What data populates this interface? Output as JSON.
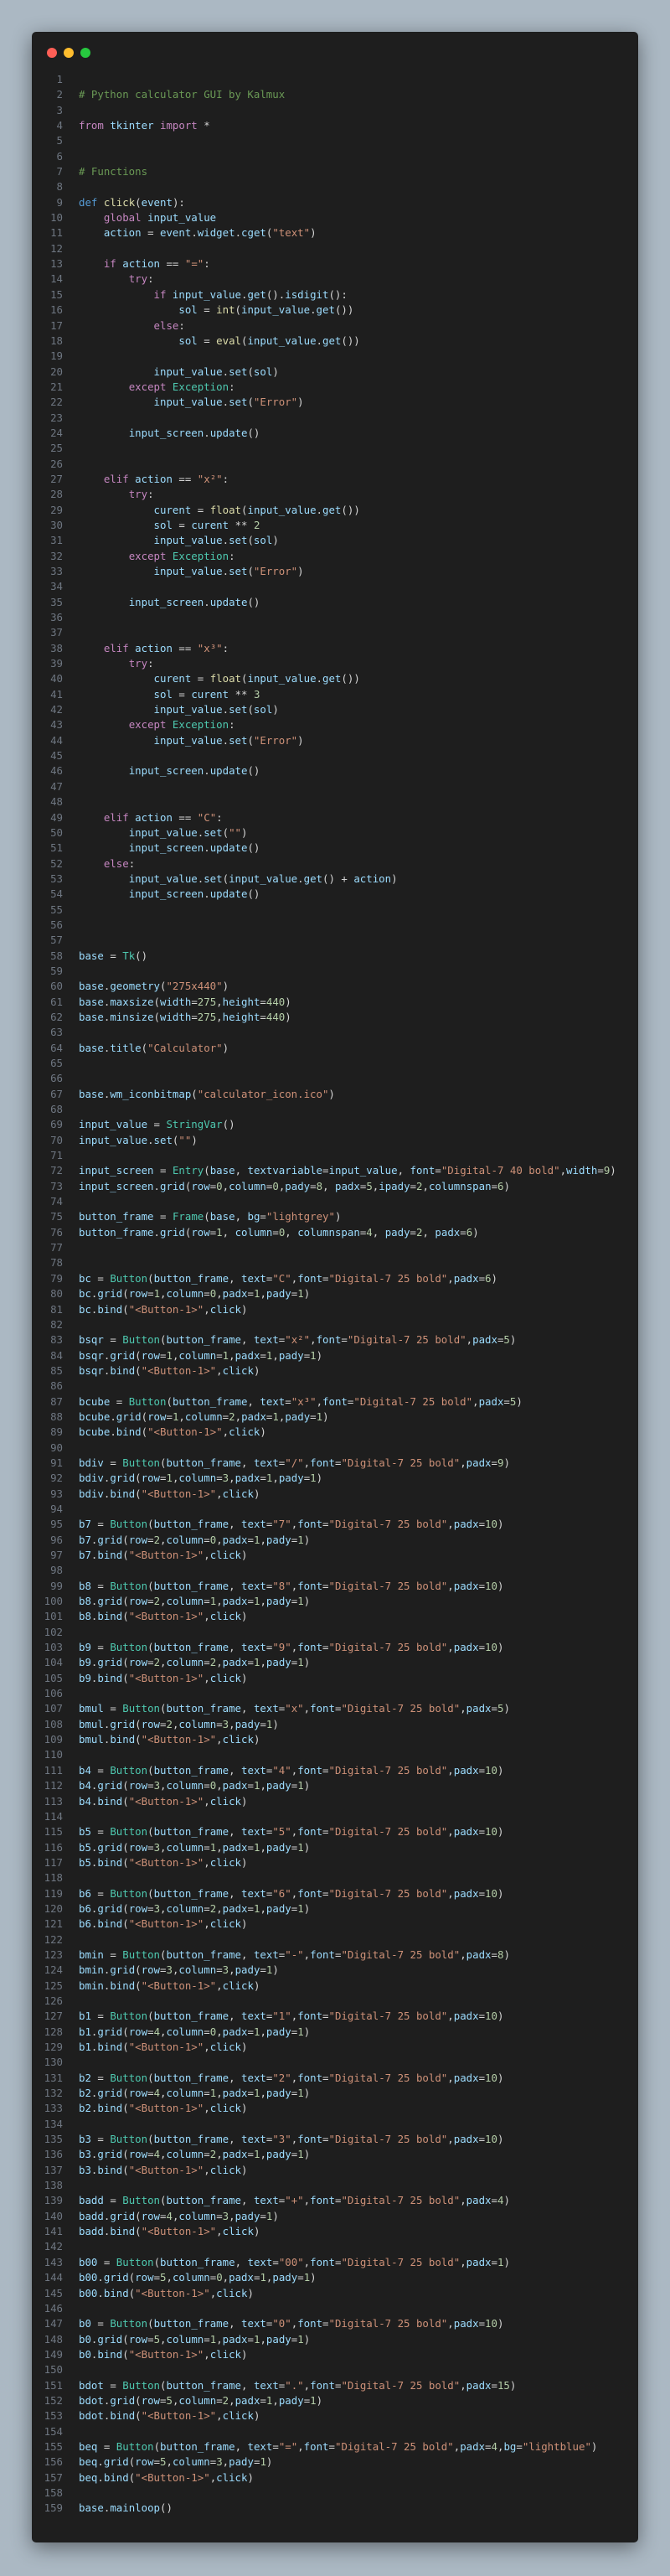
{
  "window": {
    "title_bar_buttons": [
      {
        "name": "close",
        "color": "#ff5f56"
      },
      {
        "name": "minimize",
        "color": "#ffbd2e"
      },
      {
        "name": "maximize",
        "color": "#27c93f"
      }
    ]
  },
  "theme": {
    "background": "#abb8c3",
    "editor_background": "#1e1e1e",
    "line_number_color": "#6e7681",
    "comment": "#6a9955",
    "keyword": "#c586c0",
    "string": "#ce9178",
    "number": "#b5cea8",
    "class": "#4ec9b0",
    "variable": "#9cdcfe"
  },
  "code": {
    "language": "python",
    "lines": [
      "",
      "# Python calculator GUI by Kalmux",
      "",
      "from tkinter import *",
      "",
      "",
      "# Functions",
      "",
      "def click(event):",
      "    global input_value",
      "    action = event.widget.cget(\"text\")",
      "",
      "    if action == \"=\":",
      "        try:",
      "            if input_value.get().isdigit():",
      "                sol = int(input_value.get())",
      "            else:",
      "                sol = eval(input_value.get())",
      "",
      "            input_value.set(sol)",
      "        except Exception:",
      "            input_value.set(\"Error\")",
      "",
      "        input_screen.update()",
      "",
      "",
      "    elif action == \"x²\":",
      "        try:",
      "            curent = float(input_value.get())",
      "            sol = curent ** 2",
      "            input_value.set(sol)",
      "        except Exception:",
      "            input_value.set(\"Error\")",
      "",
      "        input_screen.update()",
      "",
      "",
      "    elif action == \"x³\":",
      "        try:",
      "            curent = float(input_value.get())",
      "            sol = curent ** 3",
      "            input_value.set(sol)",
      "        except Exception:",
      "            input_value.set(\"Error\")",
      "",
      "        input_screen.update()",
      "",
      "",
      "    elif action == \"C\":",
      "        input_value.set(\"\")",
      "        input_screen.update()",
      "    else:",
      "        input_value.set(input_value.get() + action)",
      "        input_screen.update()",
      "",
      "",
      "",
      "base = Tk()",
      "",
      "base.geometry(\"275x440\")",
      "base.maxsize(width=275,height=440)",
      "base.minsize(width=275,height=440)",
      "",
      "base.title(\"Calculator\")",
      "",
      "",
      "base.wm_iconbitmap(\"calculator_icon.ico\")",
      "",
      "input_value = StringVar()",
      "input_value.set(\"\")",
      "",
      "input_screen = Entry(base, textvariable=input_value, font=\"Digital-7 40 bold\",width=9)",
      "input_screen.grid(row=0,column=0,pady=8, padx=5,ipady=2,columnspan=6)",
      "",
      "button_frame = Frame(base, bg=\"lightgrey\")",
      "button_frame.grid(row=1, column=0, columnspan=4, pady=2, padx=6)",
      "",
      "",
      "bc = Button(button_frame, text=\"C\",font=\"Digital-7 25 bold\",padx=6)",
      "bc.grid(row=1,column=0,padx=1,pady=1)",
      "bc.bind(\"<Button-1>\",click)",
      "",
      "bsqr = Button(button_frame, text=\"x²\",font=\"Digital-7 25 bold\",padx=5)",
      "bsqr.grid(row=1,column=1,padx=1,pady=1)",
      "bsqr.bind(\"<Button-1>\",click)",
      "",
      "bcube = Button(button_frame, text=\"x³\",font=\"Digital-7 25 bold\",padx=5)",
      "bcube.grid(row=1,column=2,padx=1,pady=1)",
      "bcube.bind(\"<Button-1>\",click)",
      "",
      "bdiv = Button(button_frame, text=\"/\",font=\"Digital-7 25 bold\",padx=9)",
      "bdiv.grid(row=1,column=3,padx=1,pady=1)",
      "bdiv.bind(\"<Button-1>\",click)",
      "",
      "b7 = Button(button_frame, text=\"7\",font=\"Digital-7 25 bold\",padx=10)",
      "b7.grid(row=2,column=0,padx=1,pady=1)",
      "b7.bind(\"<Button-1>\",click)",
      "",
      "b8 = Button(button_frame, text=\"8\",font=\"Digital-7 25 bold\",padx=10)",
      "b8.grid(row=2,column=1,padx=1,pady=1)",
      "b8.bind(\"<Button-1>\",click)",
      "",
      "b9 = Button(button_frame, text=\"9\",font=\"Digital-7 25 bold\",padx=10)",
      "b9.grid(row=2,column=2,padx=1,pady=1)",
      "b9.bind(\"<Button-1>\",click)",
      "",
      "bmul = Button(button_frame, text=\"x\",font=\"Digital-7 25 bold\",padx=5)",
      "bmul.grid(row=2,column=3,pady=1)",
      "bmul.bind(\"<Button-1>\",click)",
      "",
      "b4 = Button(button_frame, text=\"4\",font=\"Digital-7 25 bold\",padx=10)",
      "b4.grid(row=3,column=0,padx=1,pady=1)",
      "b4.bind(\"<Button-1>\",click)",
      "",
      "b5 = Button(button_frame, text=\"5\",font=\"Digital-7 25 bold\",padx=10)",
      "b5.grid(row=3,column=1,padx=1,pady=1)",
      "b5.bind(\"<Button-1>\",click)",
      "",
      "b6 = Button(button_frame, text=\"6\",font=\"Digital-7 25 bold\",padx=10)",
      "b6.grid(row=3,column=2,padx=1,pady=1)",
      "b6.bind(\"<Button-1>\",click)",
      "",
      "bmin = Button(button_frame, text=\"-\",font=\"Digital-7 25 bold\",padx=8)",
      "bmin.grid(row=3,column=3,pady=1)",
      "bmin.bind(\"<Button-1>\",click)",
      "",
      "b1 = Button(button_frame, text=\"1\",font=\"Digital-7 25 bold\",padx=10)",
      "b1.grid(row=4,column=0,padx=1,pady=1)",
      "b1.bind(\"<Button-1>\",click)",
      "",
      "b2 = Button(button_frame, text=\"2\",font=\"Digital-7 25 bold\",padx=10)",
      "b2.grid(row=4,column=1,padx=1,pady=1)",
      "b2.bind(\"<Button-1>\",click)",
      "",
      "b3 = Button(button_frame, text=\"3\",font=\"Digital-7 25 bold\",padx=10)",
      "b3.grid(row=4,column=2,padx=1,pady=1)",
      "b3.bind(\"<Button-1>\",click)",
      "",
      "badd = Button(button_frame, text=\"+\",font=\"Digital-7 25 bold\",padx=4)",
      "badd.grid(row=4,column=3,pady=1)",
      "badd.bind(\"<Button-1>\",click)",
      "",
      "b00 = Button(button_frame, text=\"00\",font=\"Digital-7 25 bold\",padx=1)",
      "b00.grid(row=5,column=0,padx=1,pady=1)",
      "b00.bind(\"<Button-1>\",click)",
      "",
      "b0 = Button(button_frame, text=\"0\",font=\"Digital-7 25 bold\",padx=10)",
      "b0.grid(row=5,column=1,padx=1,pady=1)",
      "b0.bind(\"<Button-1>\",click)",
      "",
      "bdot = Button(button_frame, text=\".\",font=\"Digital-7 25 bold\",padx=15)",
      "bdot.grid(row=5,column=2,padx=1,pady=1)",
      "bdot.bind(\"<Button-1>\",click)",
      "",
      "beq = Button(button_frame, text=\"=\",font=\"Digital-7 25 bold\",padx=4,bg=\"lightblue\")",
      "beq.grid(row=5,column=3,pady=1)",
      "beq.bind(\"<Button-1>\",click)",
      "",
      "base.mainloop()"
    ]
  }
}
